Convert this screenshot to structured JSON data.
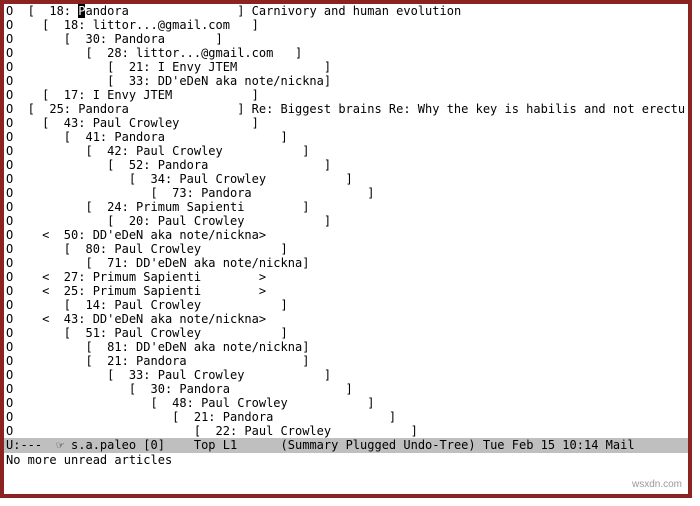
{
  "lines": [
    {
      "indent": 0,
      "open": "[",
      "close": "]",
      "count": 18,
      "author": "Pandora",
      "padTo": 22,
      "subject": " Carnivory and human evolution",
      "root": true,
      "cursor": true
    },
    {
      "indent": 1,
      "open": "[",
      "close": "]",
      "count": 18,
      "author": "littor...@gmail.com",
      "padTo": 22
    },
    {
      "indent": 2,
      "open": "[",
      "close": "]",
      "count": 30,
      "author": "Pandora",
      "padTo": 14
    },
    {
      "indent": 3,
      "open": "[",
      "close": "]",
      "count": 28,
      "author": "littor...@gmail.com",
      "padTo": 22
    },
    {
      "indent": 4,
      "open": "[",
      "close": "]",
      "count": 21,
      "author": "I Envy JTEM",
      "padTo": 23
    },
    {
      "indent": 4,
      "open": "[",
      "close": "]",
      "count": 33,
      "author": "DD'eDeN aka note/nickna",
      "padTo": 23
    },
    {
      "indent": 1,
      "open": "[",
      "close": "]",
      "count": 17,
      "author": "I Envy JTEM",
      "padTo": 22
    },
    {
      "indent": 0,
      "open": "[",
      "close": "]",
      "count": 25,
      "author": "Pandora",
      "padTo": 22,
      "subject": " Re: Biggest brains Re: Why the key is habilis and not erectus",
      "root": true
    },
    {
      "indent": 1,
      "open": "[",
      "close": "]",
      "count": 43,
      "author": "Paul Crowley",
      "padTo": 22
    },
    {
      "indent": 2,
      "open": "[",
      "close": "]",
      "count": 41,
      "author": "Pandora",
      "padTo": 23
    },
    {
      "indent": 3,
      "open": "[",
      "close": "]",
      "count": 42,
      "author": "Paul Crowley",
      "padTo": 23
    },
    {
      "indent": 4,
      "open": "[",
      "close": "]",
      "count": 52,
      "author": "Pandora",
      "padTo": 23
    },
    {
      "indent": 5,
      "open": "[",
      "close": "]",
      "count": 34,
      "author": "Paul Crowley",
      "padTo": 23
    },
    {
      "indent": 6,
      "open": "[",
      "close": "]",
      "count": 73,
      "author": "Pandora",
      "padTo": 23
    },
    {
      "indent": 3,
      "open": "[",
      "close": "]",
      "count": 24,
      "author": "Primum Sapienti",
      "padTo": 23
    },
    {
      "indent": 4,
      "open": "[",
      "close": "]",
      "count": 20,
      "author": "Paul Crowley",
      "padTo": 23
    },
    {
      "indent": 1,
      "open": "<",
      "close": ">",
      "count": 50,
      "author": "DD'eDeN aka note/nickna",
      "padTo": 23
    },
    {
      "indent": 2,
      "open": "[",
      "close": "]",
      "count": 80,
      "author": "Paul Crowley",
      "padTo": 23
    },
    {
      "indent": 3,
      "open": "[",
      "close": "]",
      "count": 71,
      "author": "DD'eDeN aka note/nickna",
      "padTo": 23
    },
    {
      "indent": 1,
      "open": "<",
      "close": ">",
      "count": 27,
      "author": "Primum Sapienti",
      "padTo": 23
    },
    {
      "indent": 1,
      "open": "<",
      "close": ">",
      "count": 25,
      "author": "Primum Sapienti",
      "padTo": 23
    },
    {
      "indent": 2,
      "open": "[",
      "close": "]",
      "count": 14,
      "author": "Paul Crowley",
      "padTo": 23
    },
    {
      "indent": 1,
      "open": "<",
      "close": ">",
      "count": 43,
      "author": "DD'eDeN aka note/nickna",
      "padTo": 23
    },
    {
      "indent": 2,
      "open": "[",
      "close": "]",
      "count": 51,
      "author": "Paul Crowley",
      "padTo": 23
    },
    {
      "indent": 3,
      "open": "[",
      "close": "]",
      "count": 81,
      "author": "DD'eDeN aka note/nickna",
      "padTo": 23
    },
    {
      "indent": 3,
      "open": "[",
      "close": "]",
      "count": 21,
      "author": "Pandora",
      "padTo": 23
    },
    {
      "indent": 4,
      "open": "[",
      "close": "]",
      "count": 33,
      "author": "Paul Crowley",
      "padTo": 23
    },
    {
      "indent": 5,
      "open": "[",
      "close": "]",
      "count": 30,
      "author": "Pandora",
      "padTo": 23
    },
    {
      "indent": 6,
      "open": "[",
      "close": "]",
      "count": 48,
      "author": "Paul Crowley",
      "padTo": 23
    },
    {
      "indent": 7,
      "open": "[",
      "close": "]",
      "count": 21,
      "author": "Pandora",
      "padTo": 23
    },
    {
      "indent": 8,
      "open": "[",
      "close": "]",
      "count": 22,
      "author": "Paul Crowley",
      "padTo": 23
    }
  ],
  "modeline": {
    "left": "U:---  ",
    "buffer_icon": "☞",
    "buffer": " s.a.paleo [0]    Top L1      (Summary Plugged Undo-Tree) Tue Feb 15 10:14 Mail"
  },
  "echo": "No more unread articles",
  "watermark": "wsxdn.com"
}
